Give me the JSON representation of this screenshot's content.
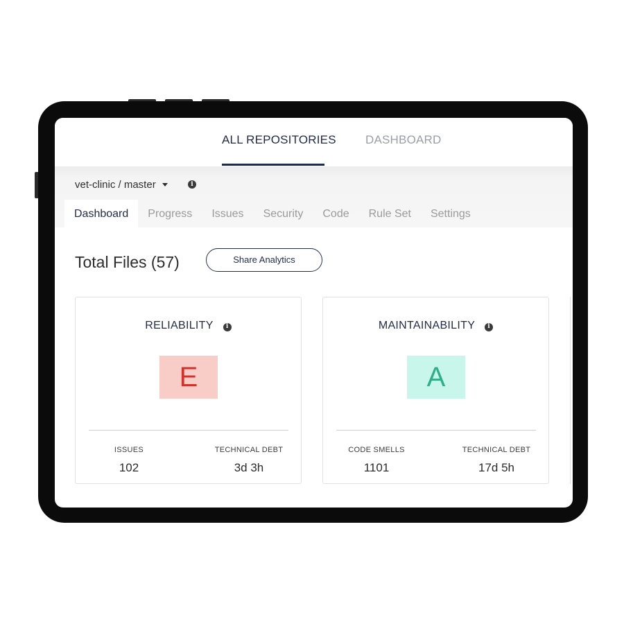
{
  "topnav": {
    "tabs": [
      {
        "label": "ALL REPOSITORIES",
        "active": true
      },
      {
        "label": "DASHBOARD",
        "active": false
      }
    ]
  },
  "repo": {
    "branch_label": "vet-clinic / master",
    "info_glyph": "i"
  },
  "subtabs": [
    {
      "label": "Dashboard",
      "active": true
    },
    {
      "label": "Progress",
      "active": false
    },
    {
      "label": "Issues",
      "active": false
    },
    {
      "label": "Security",
      "active": false
    },
    {
      "label": "Code",
      "active": false
    },
    {
      "label": "Rule Set",
      "active": false
    },
    {
      "label": "Settings",
      "active": false
    }
  ],
  "summary": {
    "total_files": "Total Files (57)",
    "share_label": "Share Analytics"
  },
  "cards": [
    {
      "title": "RELIABILITY",
      "grade": "E",
      "grade_bg": "#f8cdc8",
      "grade_color": "#d0342c",
      "metrics": [
        {
          "label": "ISSUES",
          "value": "102"
        },
        {
          "label": "TECHNICAL DEBT",
          "value": "3d 3h"
        }
      ]
    },
    {
      "title": "MAINTAINABILITY",
      "grade": "A",
      "grade_bg": "#c8f6ea",
      "grade_color": "#2fae8a",
      "metrics": [
        {
          "label": "CODE SMELLS",
          "value": "1101"
        },
        {
          "label": "TECHNICAL DEBT",
          "value": "17d 5h"
        }
      ]
    }
  ],
  "colors": {
    "accent": "#1f2a4a",
    "tablet_frame": "#0b0b0b"
  },
  "icons": {
    "info": "info-icon",
    "dropdown": "caret-down-icon"
  }
}
